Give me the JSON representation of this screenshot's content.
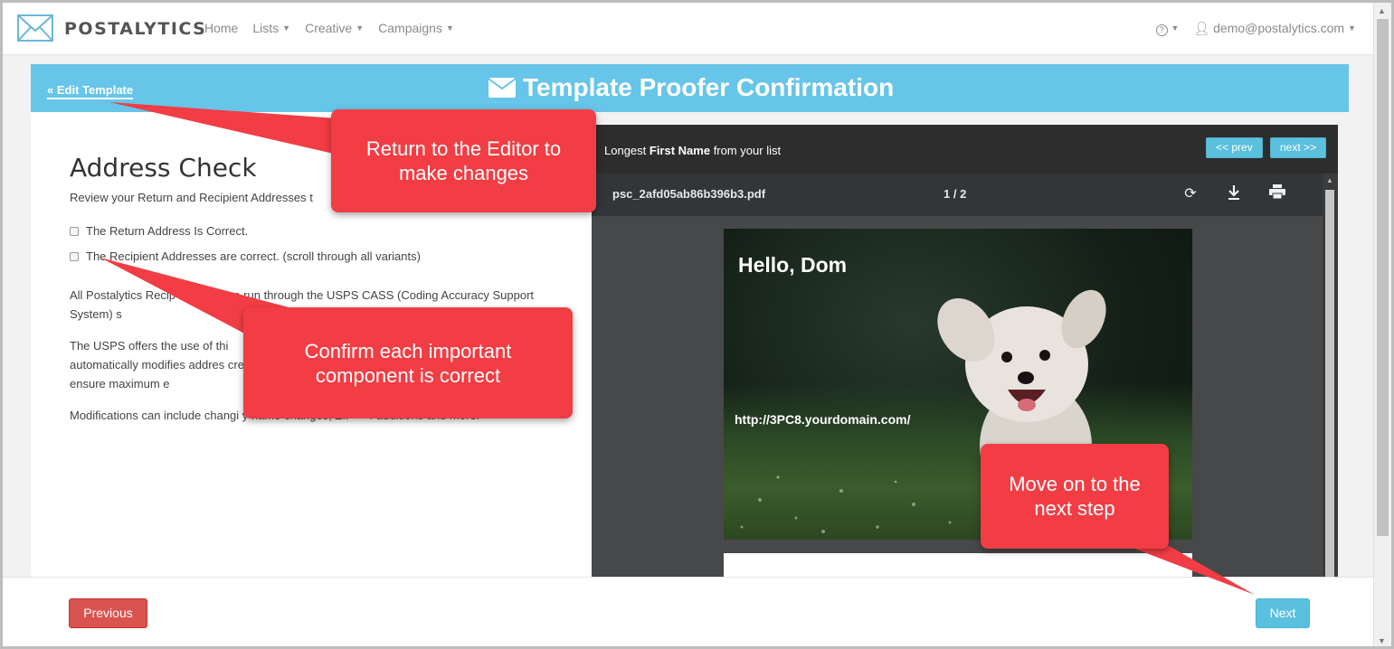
{
  "navbar": {
    "brand": "POSTALYTICS",
    "items": [
      {
        "label": "Home",
        "caret": false
      },
      {
        "label": "Lists",
        "caret": true
      },
      {
        "label": "Creative",
        "caret": true
      },
      {
        "label": "Campaigns",
        "caret": true
      }
    ],
    "help_icon": "?",
    "user_email": "demo@postalytics.com"
  },
  "header": {
    "back_link": "« Edit Template",
    "title": "Template Proofer Confirmation"
  },
  "left_panel": {
    "heading": "Address Check",
    "subtext": "Review your Return and Recipient Addresses t",
    "checkboxes": [
      {
        "label": "The Return Address Is Correct.",
        "checked": false
      },
      {
        "label": "The Recipient Addresses are correct. (scroll through all variants)",
        "checked": false
      }
    ],
    "paragraphs": [
      "All Postalytics Recip     dresses are run through the USPS CASS (Coding Accuracy Support System) s",
      "The USPS offers the use of thi automatically modifies addres created to ensure maximum e",
      "Modifications can include changi                    y name changes, ZIP + 4 additions and more."
    ]
  },
  "viewer": {
    "longest_prefix": "Longest ",
    "longest_bold": "First Name",
    "longest_suffix": " from your list",
    "prev_label": "<< prev",
    "next_label": "next >>",
    "pdf_filename": "psc_2afd05ab86b396b3.pdf",
    "pdf_page": "1 / 2",
    "postcard_greeting": "Hello, Dom",
    "postcard_url": "http://3PC8.yourdomain.com/"
  },
  "footer": {
    "previous_label": "Previous",
    "next_label": "Next"
  },
  "callouts": {
    "editor": "Return to the Editor to make changes",
    "confirm": "Confirm each important component is correct",
    "next_step": "Move on to the next step"
  },
  "colors": {
    "header_blue": "#66c5e8",
    "callout_red": "#f23d44",
    "danger": "#d9534f",
    "info": "#5bc0de"
  }
}
